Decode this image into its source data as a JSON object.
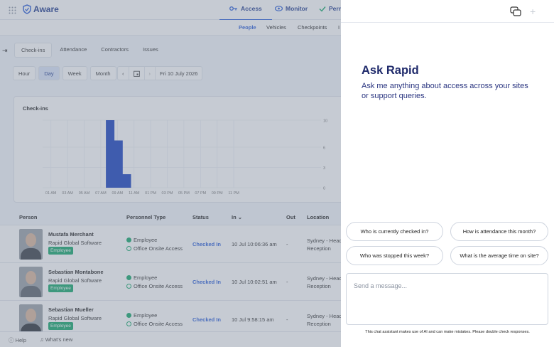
{
  "brand": {
    "name": "Aware"
  },
  "topnav": [
    {
      "label": "Access",
      "icon": "key-icon",
      "active": true
    },
    {
      "label": "Monitor",
      "icon": "eye-icon",
      "active": false
    },
    {
      "label": "Perm",
      "icon": "shield-icon",
      "active": false
    }
  ],
  "subnav": [
    "People",
    "Vehicles",
    "Checkpoints",
    "I"
  ],
  "tabs": [
    "Check-ins",
    "Attendance",
    "Contractors",
    "Issues"
  ],
  "range_buttons": [
    "Hour",
    "Day",
    "Week",
    "Month"
  ],
  "date_label": "Fri 10 July 2026",
  "chart_data": {
    "type": "bar",
    "title": "Check-ins",
    "categories": [
      "01 AM",
      "03 AM",
      "05 AM",
      "07 AM",
      "09 AM",
      "11 AM",
      "01 PM",
      "03 PM",
      "05 PM",
      "07 PM",
      "09 PM",
      "11 PM"
    ],
    "x_hours": [
      1,
      3,
      5,
      7,
      9,
      11,
      13,
      15,
      17,
      19,
      21,
      23
    ],
    "bars": [
      {
        "hour": 8,
        "value": 10
      },
      {
        "hour": 9,
        "value": 7
      },
      {
        "hour": 10,
        "value": 2
      }
    ],
    "yticks": [
      0,
      3,
      6,
      10
    ],
    "ylim": [
      0,
      10
    ],
    "color": "#1840c0",
    "grid": true
  },
  "table": {
    "headers": [
      "Person",
      "Personnel Type",
      "Status",
      "In",
      "Out",
      "Location"
    ],
    "rows": [
      {
        "name": "Mustafa Merchant",
        "company": "Rapid Global Software",
        "badge": "Employee",
        "type1": "Employee",
        "type2": "Office Onsite Access",
        "status": "Checked In",
        "in": "10 Jul 10:06:36 am",
        "out": "-",
        "loc1": "Sydney - Head",
        "loc2": "Reception"
      },
      {
        "name": "Sebastian Montabone",
        "company": "Rapid Global Software",
        "badge": "Employee",
        "type1": "Employee",
        "type2": "Office Onsite Access",
        "status": "Checked In",
        "in": "10 Jul 10:02:51 am",
        "out": "-",
        "loc1": "Sydney - Head",
        "loc2": "Reception"
      },
      {
        "name": "Sebastian Mueller",
        "company": "Rapid Global Software",
        "badge": "Employee",
        "type1": "Employee",
        "type2": "Office Onsite Access",
        "status": "Checked In",
        "in": "10 Jul 9:58:15 am",
        "out": "-",
        "loc1": "Sydney - Head",
        "loc2": "Reception"
      }
    ]
  },
  "footer": {
    "help": "Help",
    "whats_new": "What's new"
  },
  "chat": {
    "title": "Ask Rapid",
    "subtitle": "Ask me anything about access across your sites or support queries.",
    "suggestions": [
      "Who is currently checked in?",
      "How is attendance this month?",
      "Who was stopped this week?",
      "What is the average time on site?"
    ],
    "input_placeholder": "Send a message...",
    "disclaimer": "This chat assistant makes use of AI and can make mistakes. Please double check responses."
  },
  "colors": {
    "accent": "#2b5fd9",
    "brand": "#1f3b8f",
    "badge": "#13a86b",
    "bar": "#1840c0"
  }
}
